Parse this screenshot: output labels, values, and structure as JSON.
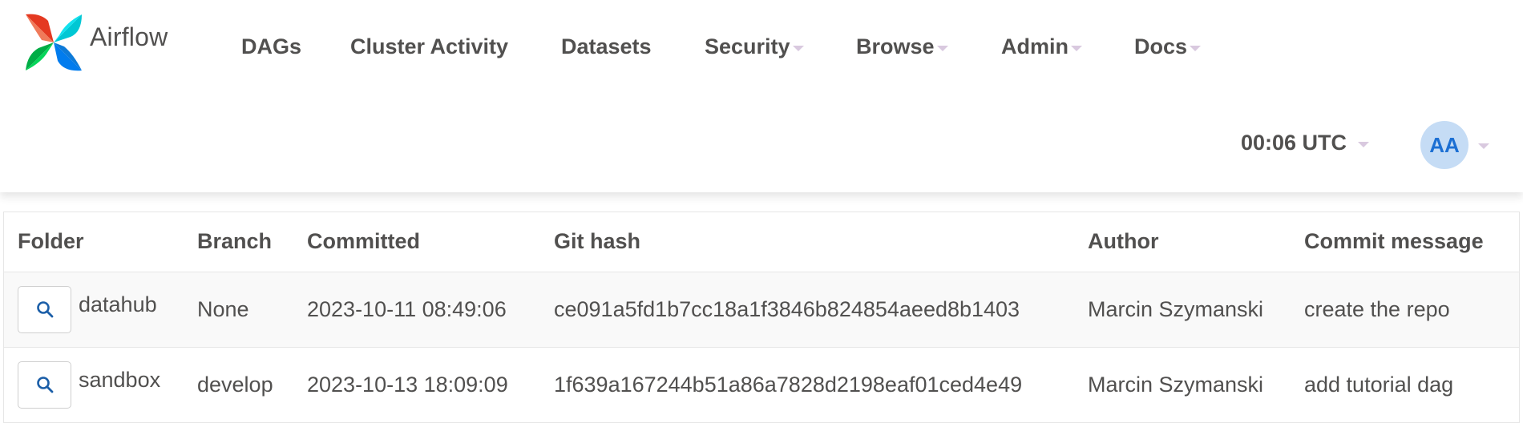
{
  "brand": {
    "name": "Airflow"
  },
  "nav": {
    "items": [
      {
        "label": "DAGs",
        "dropdown": false
      },
      {
        "label": "Cluster Activity",
        "dropdown": false
      },
      {
        "label": "Datasets",
        "dropdown": false
      },
      {
        "label": "Security",
        "dropdown": true
      },
      {
        "label": "Browse",
        "dropdown": true
      },
      {
        "label": "Admin",
        "dropdown": true
      },
      {
        "label": "Docs",
        "dropdown": true
      }
    ],
    "clock": "00:06 UTC",
    "user_initials": "AA"
  },
  "table": {
    "columns": [
      "Folder",
      "Branch",
      "Committed",
      "Git hash",
      "Author",
      "Commit message"
    ],
    "rows": [
      {
        "folder": "datahub",
        "branch": "None",
        "committed": "2023-10-11 08:49:06",
        "git_hash": "ce091a5fd1b7cc18a1f3846b824854aeed8b1403",
        "author": "Marcin Szymanski",
        "message": "create the repo"
      },
      {
        "folder": "sandbox",
        "branch": "develop",
        "committed": "2023-10-13 18:09:09",
        "git_hash": "1f639a167244b51a86a7828d2198eaf01ced4e49",
        "author": "Marcin Szymanski",
        "message": "add tutorial dag"
      }
    ]
  },
  "icons": {
    "search": "search-icon",
    "logo": "airflow-logo-icon",
    "dropdown": "chevron-down-icon"
  },
  "colors": {
    "avatar_bg": "#c5dcf5",
    "avatar_text": "#1c6fd3",
    "caret": "#d9c9df",
    "search_icon": "#1c5fa8"
  }
}
